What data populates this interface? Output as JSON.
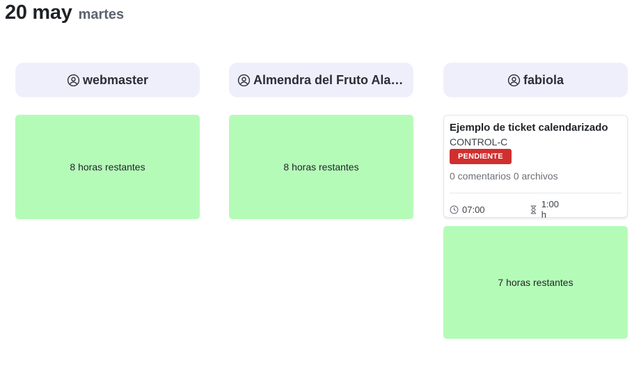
{
  "header": {
    "date": "20 may",
    "weekday": "martes"
  },
  "columns": [
    {
      "user": {
        "icon": "user-circle-icon",
        "name": "webmaster"
      },
      "remaining": "8 horas restantes"
    },
    {
      "user": {
        "icon": "user-circle-icon",
        "name": "Almendra del Fruto Alam..."
      },
      "remaining": "8 horas restantes"
    },
    {
      "user": {
        "icon": "user-circle-icon",
        "name": "fabiola"
      },
      "ticket": {
        "title": "Ejemplo de ticket calendarizado",
        "code": "CONTROL-C",
        "status": "PENDIENTE",
        "meta": "0 comentarios 0 archivos",
        "start_icon": "clock-icon",
        "start_time": "07:00",
        "duration_icon": "hourglass-icon",
        "duration": "1:00 h"
      },
      "remaining": "7 horas restantes"
    }
  ],
  "colors": {
    "user_pill_bg": "#efeffc",
    "remaining_bg": "#b5fbb8",
    "status_badge_bg": "#d12f2f"
  }
}
